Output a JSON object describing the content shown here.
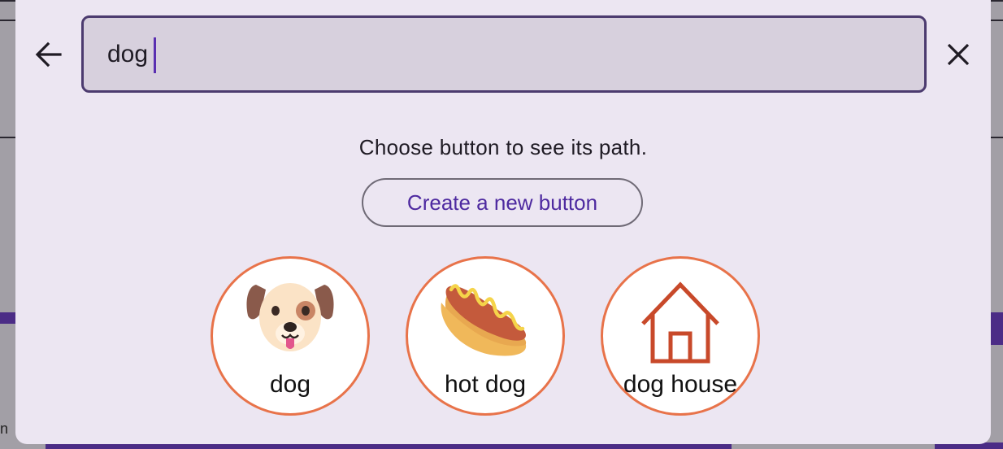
{
  "search": {
    "value": "dog",
    "back_icon": "arrow-left-icon",
    "clear_icon": "close-icon"
  },
  "hint_text": "Choose button to see its path.",
  "create_button_label": "Create a new button",
  "results": [
    {
      "label": "dog",
      "icon": "dog-face-icon"
    },
    {
      "label": "hot dog",
      "icon": "hot-dog-icon"
    },
    {
      "label": "dog house",
      "icon": "house-icon"
    }
  ],
  "background_text": "n",
  "colors": {
    "dialog_bg": "#ece6f2",
    "search_bg": "#d7d0dd",
    "search_border": "#4c3b6f",
    "accent": "#4e2aa0",
    "result_border": "#e8734a"
  }
}
